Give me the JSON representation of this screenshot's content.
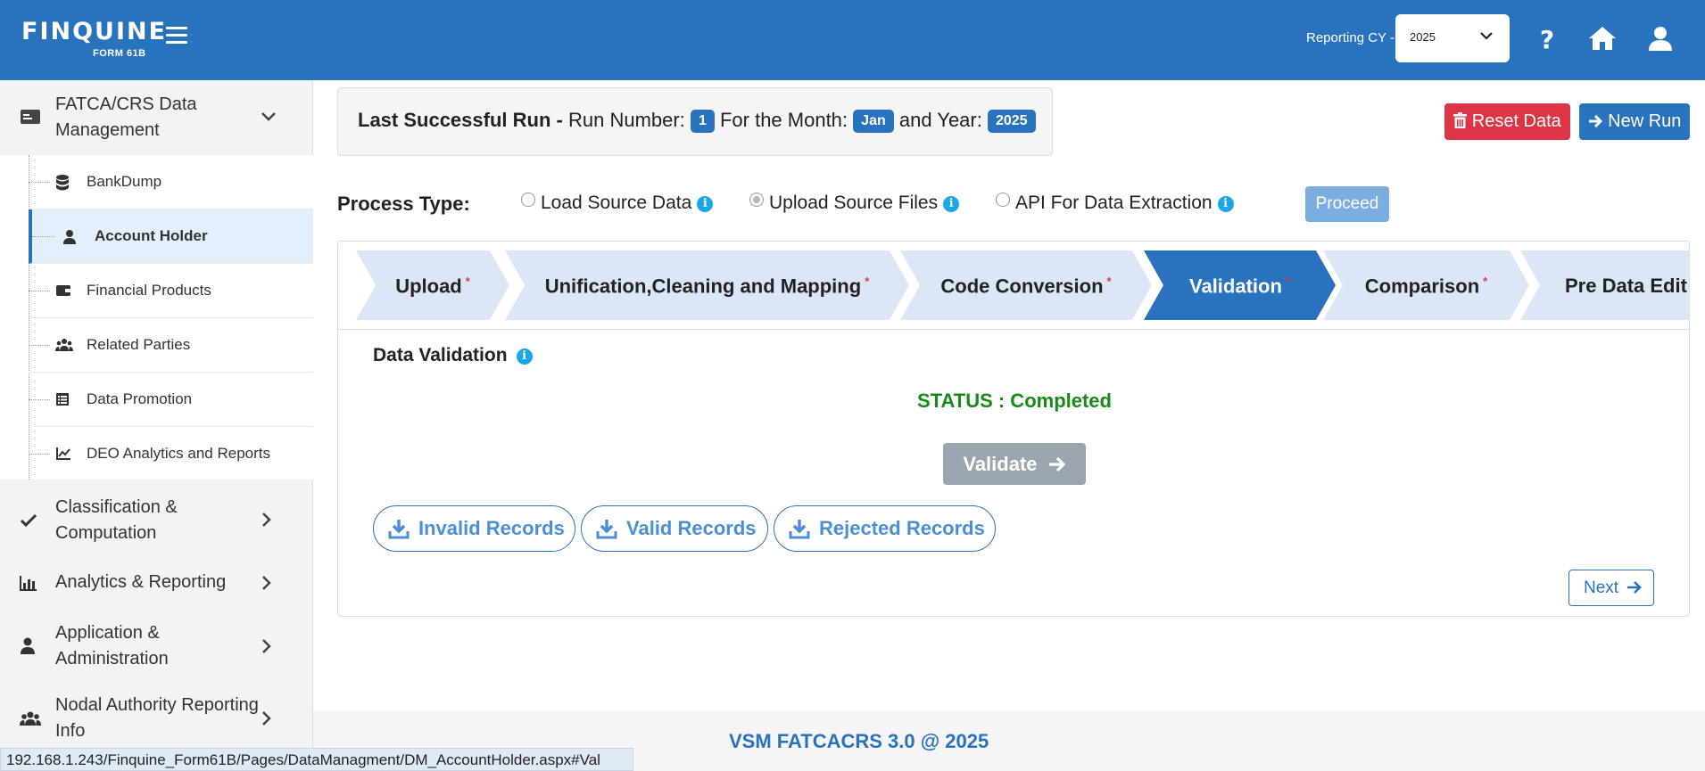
{
  "app": {
    "logo_text": "FINQUINE",
    "logo_sub": "FORM 61B",
    "reporting_label": "Reporting CY -",
    "reporting_value": "2025"
  },
  "sidebar": {
    "items": [
      {
        "label": "FATCA/CRS Data Management",
        "line1": "FATCA/CRS Data",
        "line2": "Management",
        "icon": "card-icon",
        "expanded": true
      },
      {
        "label": "Classification & Computation",
        "line1": "Classification &",
        "line2": "Computation",
        "icon": "check-icon"
      },
      {
        "label": "Analytics & Reporting",
        "line1": "Analytics & Reporting",
        "icon": "bar-chart-icon"
      },
      {
        "label": "Application & Administration",
        "line1": "Application &",
        "line2": "Administration",
        "icon": "user-icon"
      },
      {
        "label": "Nodal Authority Reporting Info",
        "line1": "Nodal Authority Reporting",
        "line2": "Info",
        "icon": "users-icon"
      }
    ],
    "submenu": [
      {
        "label": "BankDump",
        "icon": "database-icon"
      },
      {
        "label": "Account Holder",
        "icon": "account-user-icon",
        "active": true
      },
      {
        "label": "Financial Products",
        "icon": "wallet-icon"
      },
      {
        "label": "Related Parties",
        "icon": "people-icon"
      },
      {
        "label": "Data Promotion",
        "icon": "list-icon"
      },
      {
        "label": "DEO Analytics and Reports",
        "icon": "line-chart-icon"
      }
    ]
  },
  "last_run": {
    "prefix": "Last Successful Run -",
    "run_label": "Run Number:",
    "run_number": "1",
    "month_label": "For the Month:",
    "month": "Jan",
    "year_label": "and Year:",
    "year": "2025"
  },
  "actions": {
    "reset": "Reset Data",
    "new_run": "New Run"
  },
  "process_type": {
    "label": "Process Type:",
    "options": [
      "Load Source Data",
      "Upload Source Files",
      "API For Data Extraction"
    ],
    "selected": "Upload Source Files",
    "proceed": "Proceed"
  },
  "steps": [
    "Upload",
    "Unification,Cleaning and Mapping",
    "Code Conversion",
    "Validation",
    "Comparison",
    "Pre Data Edit"
  ],
  "active_step": "Validation",
  "validation": {
    "title": "Data Validation",
    "status": "STATUS : Completed",
    "validate_button": "Validate",
    "downloads": [
      "Invalid Records",
      "Valid Records",
      "Rejected Records"
    ],
    "next": "Next"
  },
  "footer": "VSM FATCACRS 3.0 @ 2025",
  "status_url": "192.168.1.243/Finquine_Form61B/Pages/DataManagment/DM_AccountHolder.aspx#Val",
  "colors": {
    "primary": "#2872be",
    "danger": "#dc3545",
    "success": "#188a18",
    "info": "#1aa7e8"
  }
}
